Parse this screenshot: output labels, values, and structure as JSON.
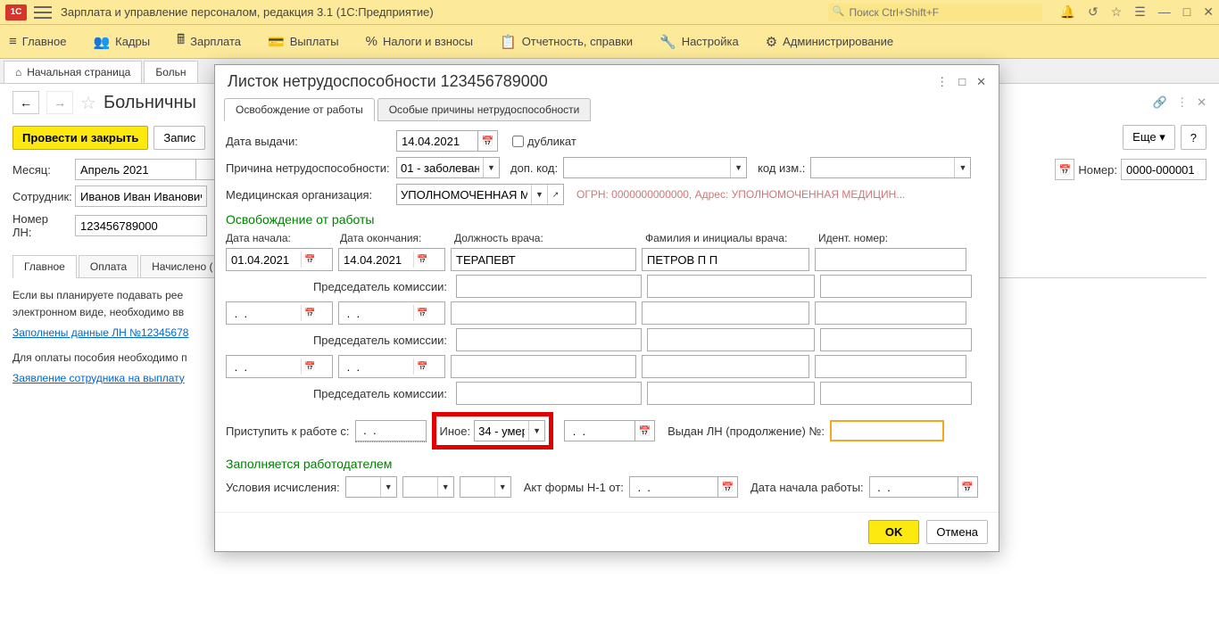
{
  "titlebar": {
    "app_title": "Зарплата и управление персоналом, редакция 3.1  (1С:Предприятие)",
    "search_placeholder": "Поиск Ctrl+Shift+F"
  },
  "menubar": {
    "items": [
      {
        "icon": "≡",
        "label": "Главное"
      },
      {
        "icon": "👥",
        "label": "Кадры"
      },
      {
        "icon": "🖩",
        "label": "Зарплата"
      },
      {
        "icon": "💳",
        "label": "Выплаты"
      },
      {
        "icon": "%",
        "label": "Налоги и взносы"
      },
      {
        "icon": "📋",
        "label": "Отчетность, справки"
      },
      {
        "icon": "🔧",
        "label": "Настройка"
      },
      {
        "icon": "⚙",
        "label": "Администрирование"
      }
    ]
  },
  "tabstrip": {
    "items": [
      {
        "icon": "⌂",
        "label": "Начальная страница"
      },
      {
        "icon": "",
        "label": "Больн"
      }
    ]
  },
  "page": {
    "title": "Больничны",
    "buttons": {
      "submit": "Провести и закрыть",
      "write": "Запис",
      "more": "Еще",
      "help": "?"
    },
    "month_label": "Месяц:",
    "month_value": "Апрель 2021",
    "number_label": "Номер:",
    "number_value": "0000-000001",
    "employee_label": "Сотрудник:",
    "employee_value": "Иванов Иван Иванович",
    "ln_label": "Номер ЛН:",
    "ln_value": "123456789000",
    "sec_tabs": [
      "Главное",
      "Оплата",
      "Начислено ("
    ],
    "info_text1": "Если вы планируете подавать рее",
    "info_text2": "электронном виде, необходимо вв",
    "link1": "Заполнены данные ЛН №12345678",
    "info_text3": "Для оплаты пособия необходимо п",
    "link2": "Заявление сотрудника на выплату"
  },
  "modal": {
    "title": "Листок нетрудоспособности 123456789000",
    "tabs": [
      "Освобождение от работы",
      "Особые причины нетрудоспособности"
    ],
    "issue_date_label": "Дата выдачи:",
    "issue_date": "14.04.2021",
    "duplicate_label": "дубликат",
    "reason_label": "Причина нетрудоспособности:",
    "reason_value": "01 - заболевани",
    "addcode_label": "доп. код:",
    "chgcode_label": "код изм.:",
    "medorg_label": "Медицинская организация:",
    "medorg_value": "УПОЛНОМОЧЕННАЯ МЕ",
    "ogrn_text": "ОГРН: 0000000000000, Адрес: УПОЛНОМОЧЕННАЯ МЕДИЦИН...",
    "section1": "Освобождение от работы",
    "cols": {
      "start": "Дата начала:",
      "end": "Дата окончания:",
      "position": "Должность врача:",
      "doctor": "Фамилия и инициалы врача:",
      "ident": "Идент.  номер:"
    },
    "row1": {
      "start": "01.04.2021",
      "end": "14.04.2021",
      "position": "ТЕРАПЕВТ",
      "doctor": "ПЕТРОВ П П"
    },
    "chairman": "Председатель комиссии:",
    "empty_date": " .  .    ",
    "return_label": "Приступить к работе с:",
    "other_label": "Иное:",
    "other_value": "34 - умер",
    "cont_label": "Выдан ЛН (продолжение) №:",
    "section2": "Заполняется работодателем",
    "calc_label": "Условия исчисления:",
    "act_label": "Акт формы Н-1 от:",
    "workstart_label": "Дата начала работы:",
    "ok": "OK",
    "cancel": "Отмена"
  }
}
